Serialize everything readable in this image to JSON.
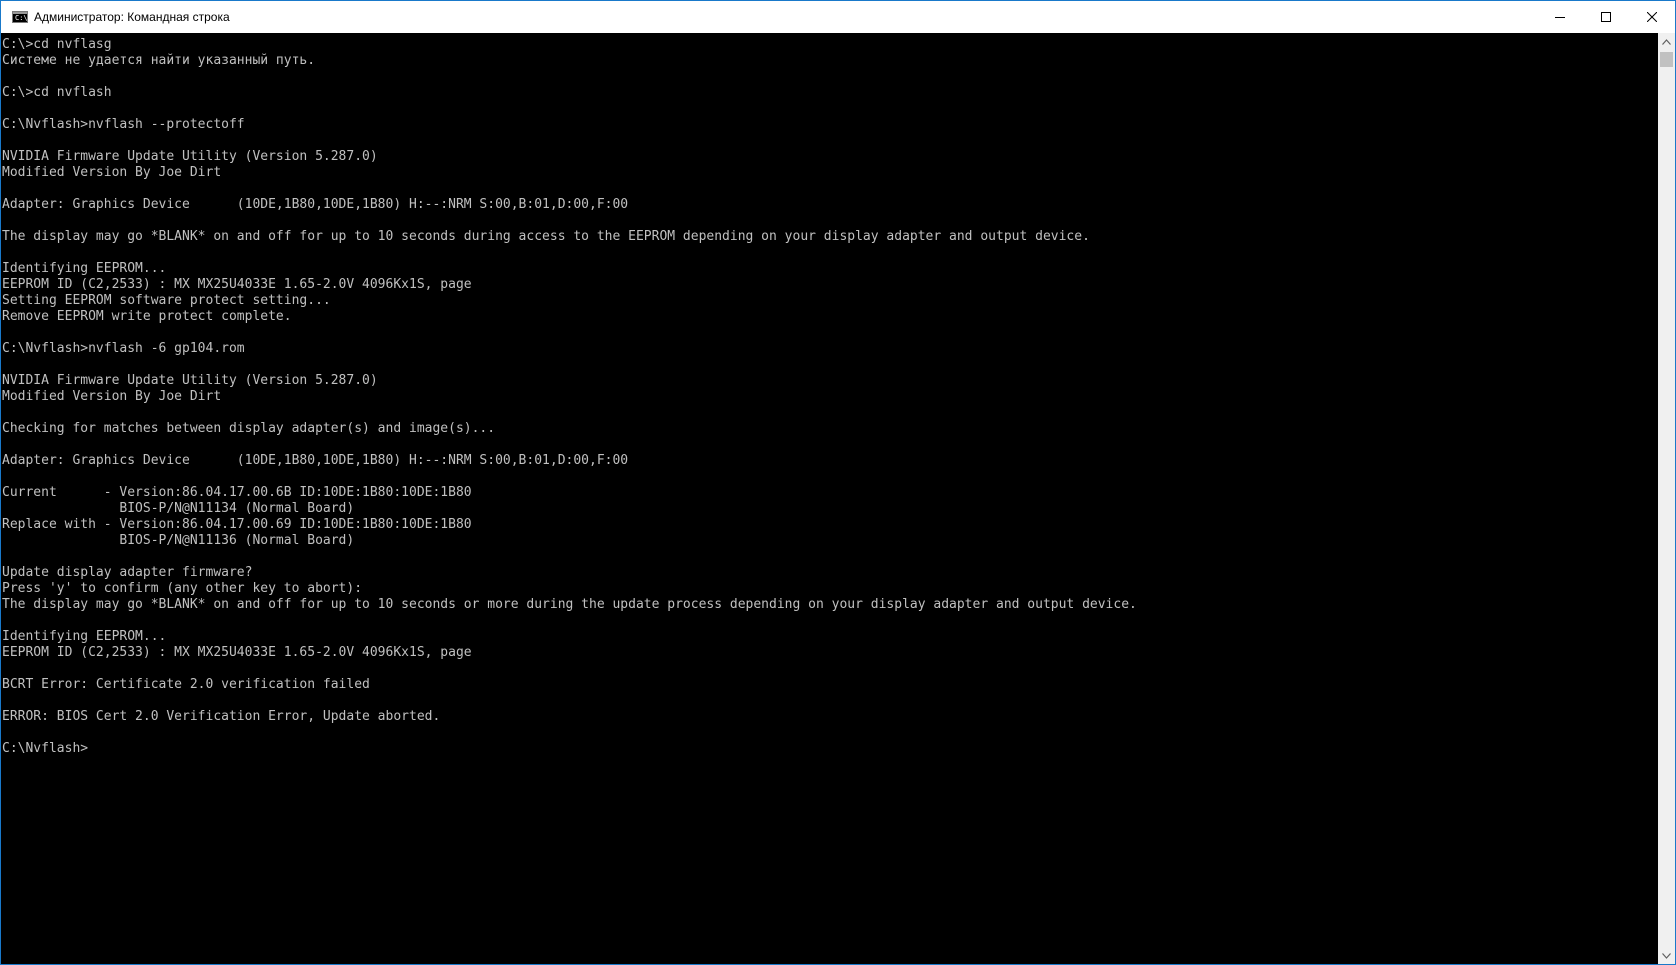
{
  "window": {
    "title": "Администратор: Командная строка",
    "icon_label": "C:\\"
  },
  "controls": {
    "minimize": "minimize-icon",
    "maximize": "maximize-icon",
    "close": "close-icon"
  },
  "console": {
    "text": "C:\\>cd nvflasg\nСистеме не удается найти указанный путь.\n\nC:\\>cd nvflash\n\nC:\\Nvflash>nvflash --protectoff\n\nNVIDIA Firmware Update Utility (Version 5.287.0)\nModified Version By Joe Dirt\n\nAdapter: Graphics Device      (10DE,1B80,10DE,1B80) H:--:NRM S:00,B:01,D:00,F:00\n\nThe display may go *BLANK* on and off for up to 10 seconds during access to the EEPROM depending on your display adapter and output device.\n\nIdentifying EEPROM...\nEEPROM ID (C2,2533) : MX MX25U4033E 1.65-2.0V 4096Kx1S, page\nSetting EEPROM software protect setting...\nRemove EEPROM write protect complete.\n\nC:\\Nvflash>nvflash -6 gp104.rom\n\nNVIDIA Firmware Update Utility (Version 5.287.0)\nModified Version By Joe Dirt\n\nChecking for matches between display adapter(s) and image(s)...\n\nAdapter: Graphics Device      (10DE,1B80,10DE,1B80) H:--:NRM S:00,B:01,D:00,F:00\n\nCurrent      - Version:86.04.17.00.6B ID:10DE:1B80:10DE:1B80\n               BIOS-P/N@N11134 (Normal Board)\nReplace with - Version:86.04.17.00.69 ID:10DE:1B80:10DE:1B80\n               BIOS-P/N@N11136 (Normal Board)\n\nUpdate display adapter firmware?\nPress 'y' to confirm (any other key to abort):\nThe display may go *BLANK* on and off for up to 10 seconds or more during the update process depending on your display adapter and output device.\n\nIdentifying EEPROM...\nEEPROM ID (C2,2533) : MX MX25U4033E 1.65-2.0V 4096Kx1S, page\n\nBCRT Error: Certificate 2.0 verification failed\n\nERROR: BIOS Cert 2.0 Verification Error, Update aborted.\n\nC:\\Nvflash>"
  },
  "colors": {
    "console_bg": "#000000",
    "console_fg": "#c0c0c0",
    "titlebar_bg": "#ffffff",
    "window_border": "#1979ca"
  }
}
